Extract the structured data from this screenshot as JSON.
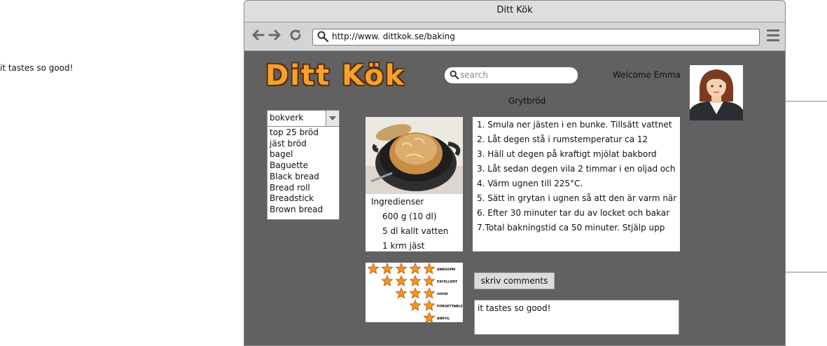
{
  "side_note": "it tastes so good!",
  "window": {
    "title": "Ditt Kök"
  },
  "toolbar": {
    "url": "http://www. dittkok.se/baking",
    "back_icon": "arrow-left-icon",
    "forward_icon": "arrow-right-icon",
    "reload_icon": "reload-icon",
    "menu_icon": "hamburger-menu-icon"
  },
  "header": {
    "logo": "Ditt Kök",
    "search_placeholder": "search",
    "welcome": "Welcome Emma"
  },
  "recipe": {
    "title": "Grytbröd",
    "category": {
      "selected": "bokverk",
      "items": [
        "top 25 bröd",
        "jäst bröd",
        "bagel",
        "Baguette",
        "Black bread",
        "Bread roll",
        "Breadstick",
        "Brown bread"
      ]
    },
    "ingredients": {
      "heading": "Ingredienser",
      "rows": [
        "600 g (10 dl)",
        "5 dl kallt vatten",
        "1 krm jäst"
      ]
    },
    "steps": [
      "1. Smula ner jästen i en bunke. Tillsätt vattnet",
      "2. Låt degen stå i rumstemperatur ca 12",
      "3. Häll ut degen på kraftigt mjölat bakbord",
      "3. Låt sedan degen vila 2 timmar i en oljad och",
      "4. Värm ugnen till 225°C.",
      "5. Sätt in grytan i ugnen så att den är varm när",
      " 6. Efter 30 minuter tar du av locket och bakar",
      " 7.Total bakningstid ca 50 minuter. Stjälp upp"
    ]
  },
  "rating": {
    "labels": [
      "AWESOME",
      "EXCELLENT",
      "GOOD",
      "FORGETTABLE",
      "AWFUL"
    ],
    "star_color": "#f7931e"
  },
  "comments": {
    "button_label": "skriv comments",
    "text": "it tastes so good!"
  },
  "colors": {
    "page_bg": "#616161",
    "logo_fill": "#f7a12a"
  }
}
